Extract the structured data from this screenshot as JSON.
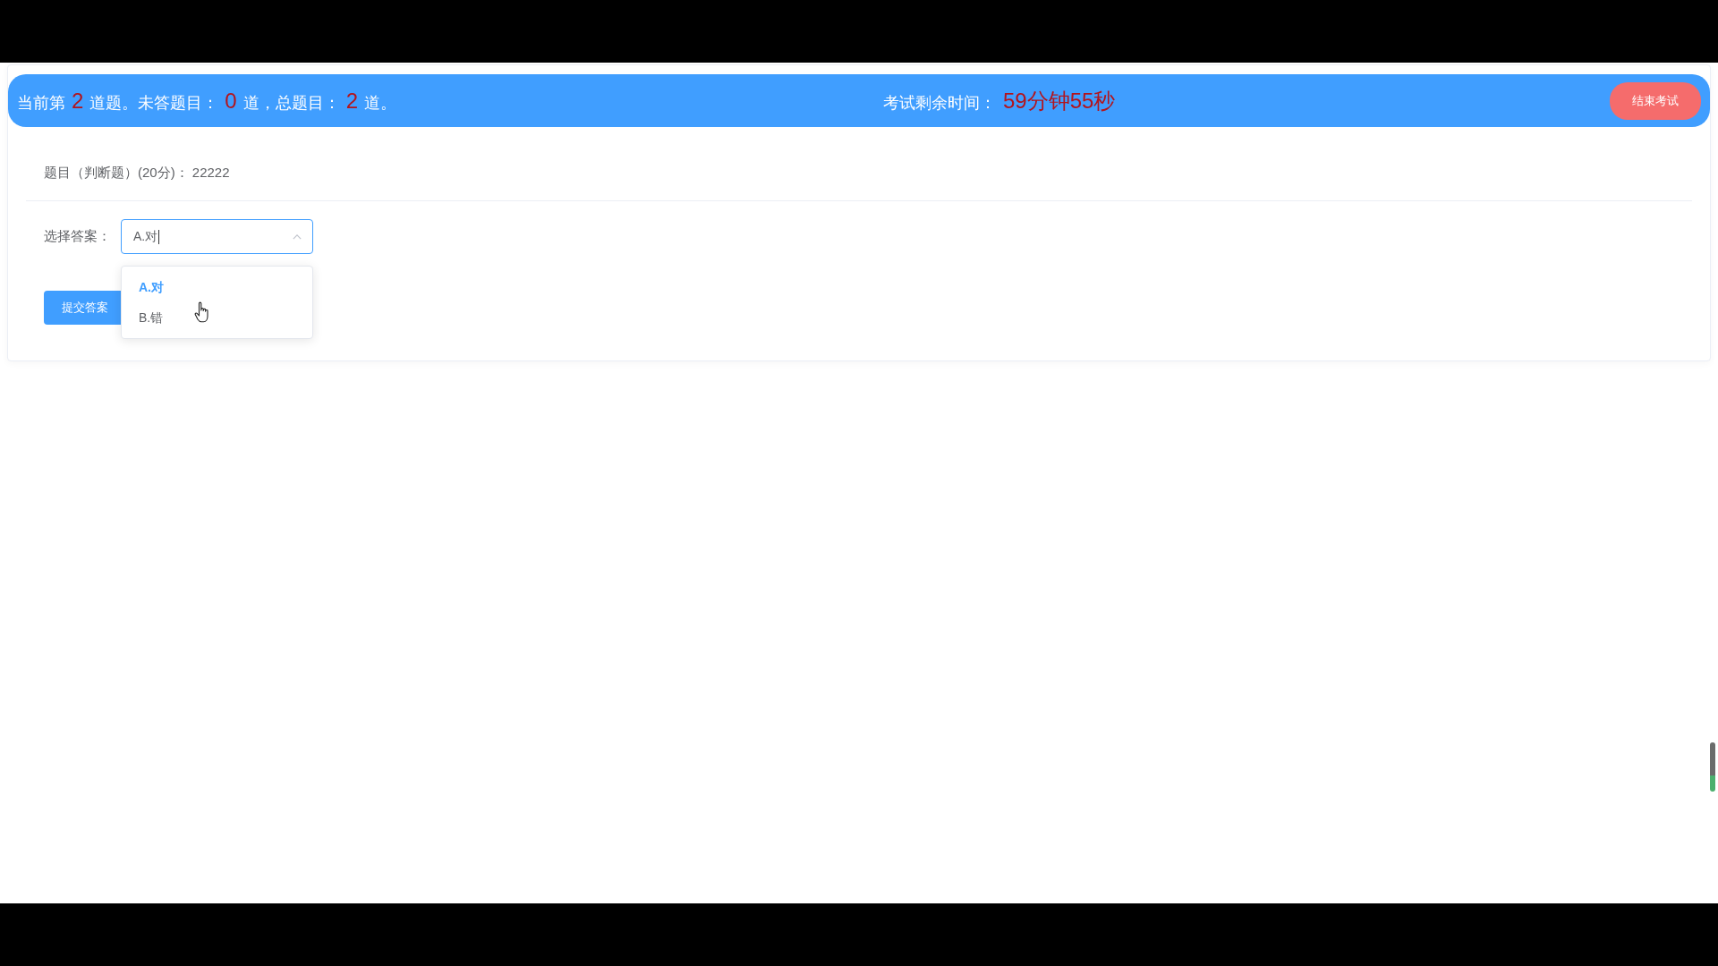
{
  "exam_header": {
    "progress": [
      {
        "kind": "text",
        "text": "当前第"
      },
      {
        "kind": "number",
        "text": "2"
      },
      {
        "kind": "text",
        "text": "道题。未答题目："
      },
      {
        "kind": "number",
        "text": "0"
      },
      {
        "kind": "text",
        "text": "道，总题目："
      },
      {
        "kind": "number",
        "text": "2"
      },
      {
        "kind": "text",
        "text": "道。"
      }
    ],
    "timer_label": "考试剩余时间：",
    "timer_value": "59分钟55秒",
    "end_button": "结束考试"
  },
  "question": {
    "text": "题目（判断题）(20分)： 22222"
  },
  "answer": {
    "label": "选择答案：",
    "select": {
      "value": "A.对",
      "focused": true,
      "open": true
    },
    "options": [
      {
        "label": "A.对",
        "selected": true
      },
      {
        "label": "B.错",
        "selected": false
      }
    ]
  },
  "submit_button": "提交答案"
}
